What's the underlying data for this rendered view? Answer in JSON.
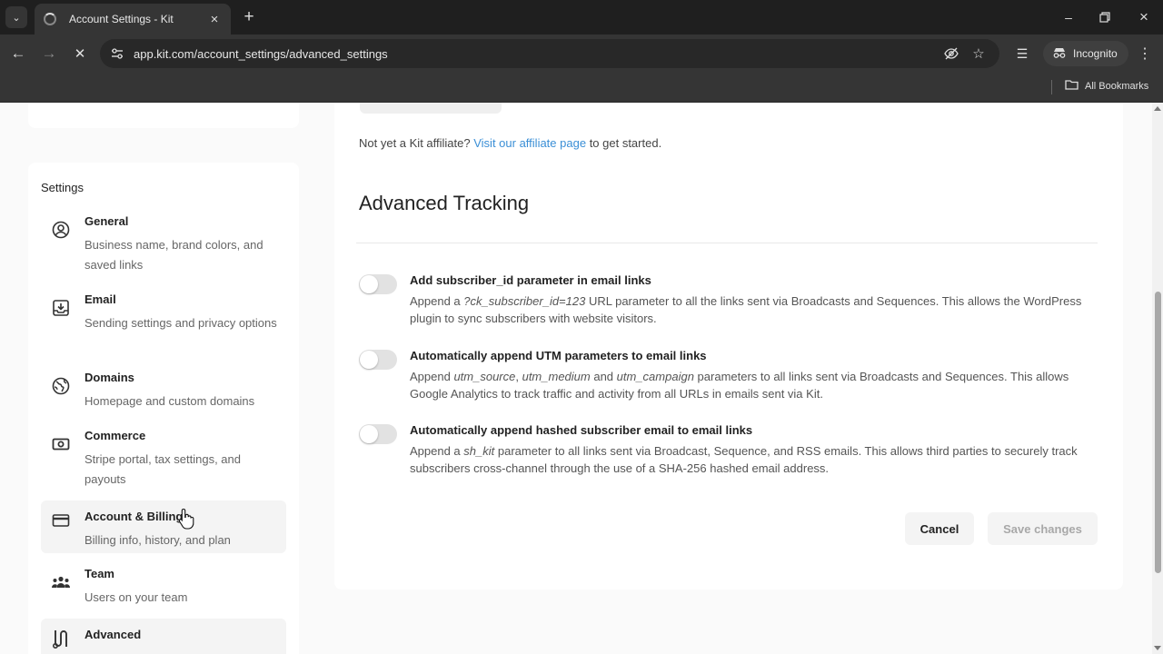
{
  "browser": {
    "tab_title": "Account Settings - Kit",
    "new_tab_symbol": "+",
    "url": "app.kit.com/account_settings/advanced_settings",
    "incognito_label": "Incognito",
    "all_bookmarks_label": "All Bookmarks"
  },
  "sidebar": {
    "heading": "Settings",
    "items": [
      {
        "title": "General",
        "description": "Business name, brand colors, and saved links",
        "icon": "person-circle-icon"
      },
      {
        "title": "Email",
        "description": "Sending settings and privacy options",
        "icon": "inbox-download-icon"
      },
      {
        "title": "Domains",
        "description": "Homepage and custom domains",
        "icon": "globe-icon"
      },
      {
        "title": "Commerce",
        "description": "Stripe portal, tax settings, and payouts",
        "icon": "cash-icon"
      },
      {
        "title": "Account & Billing",
        "description": "Billing info, history, and plan",
        "icon": "credit-card-icon"
      },
      {
        "title": "Team",
        "description": "Users on your team",
        "icon": "team-icon"
      },
      {
        "title": "Advanced",
        "description": "",
        "icon": "advanced-icon"
      }
    ]
  },
  "main": {
    "affiliate_prefix": "Not yet a Kit affiliate?",
    "affiliate_link": "Visit our affiliate page",
    "affiliate_suffix": "to get started.",
    "section_title": "Advanced Tracking",
    "options": [
      {
        "title": "Add subscriber_id parameter in email links",
        "enabled": false,
        "desc_parts": [
          "Append a ",
          "?ck_subscriber_id=123",
          " URL parameter to all the links sent via Broadcasts and Sequences. This allows the WordPress plugin to sync subscribers with website visitors."
        ]
      },
      {
        "title": "Automatically append UTM parameters to email links",
        "enabled": false,
        "desc_parts": [
          "Append ",
          "utm_source",
          ", ",
          "utm_medium",
          " and ",
          "utm_campaign",
          " parameters to all links sent via Broadcasts and Sequences. This allows Google Analytics to track traffic and activity from all URLs in emails sent via Kit."
        ]
      },
      {
        "title": "Automatically append hashed subscriber email to email links",
        "enabled": false,
        "desc_parts": [
          "Append a ",
          "sh_kit",
          " parameter to all links sent via Broadcast, Sequence, and RSS emails. This allows third parties to securely track subscribers cross-channel through the use of a SHA-256 hashed email address."
        ]
      }
    ],
    "cancel_label": "Cancel",
    "save_label": "Save changes"
  },
  "colors": {
    "link": "#3b8fd6",
    "toggle_off": "#e2e2e2",
    "chrome_dark": "#1f1f1f"
  }
}
